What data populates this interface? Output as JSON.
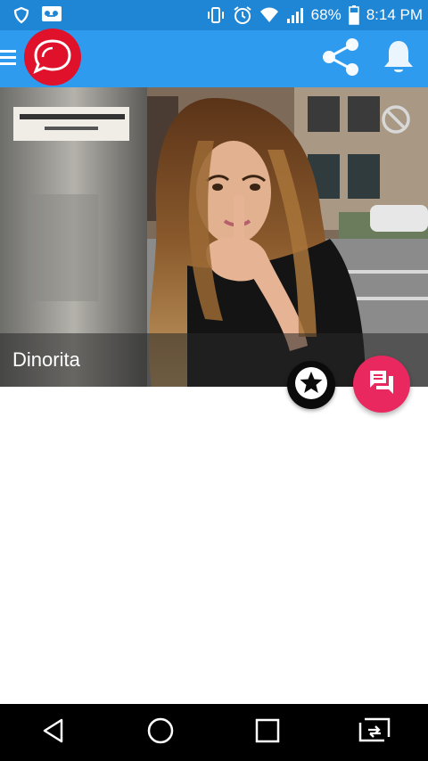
{
  "status_bar": {
    "battery_percent": "68%",
    "time": "8:14 PM",
    "icons": [
      "shield-icon",
      "voicemail-icon",
      "vibrate-icon",
      "alarm-icon",
      "wifi-icon",
      "signal-icon",
      "battery-icon"
    ]
  },
  "app_bar": {
    "icons": [
      "menu-icon",
      "chat-logo-icon",
      "share-icon",
      "bell-icon"
    ],
    "accent_color": "#2e9bef",
    "logo_color": "#e0112b"
  },
  "profile": {
    "name": "Dinorita",
    "photo_icon": "profile-photo",
    "block_icon": "block-icon"
  },
  "actions": {
    "favorite_icon": "star-icon",
    "message_icon": "message-icon",
    "message_color": "#e9285f"
  },
  "nav_bar": {
    "icons": [
      "back-icon",
      "home-icon",
      "recents-icon",
      "switch-app-icon"
    ]
  }
}
